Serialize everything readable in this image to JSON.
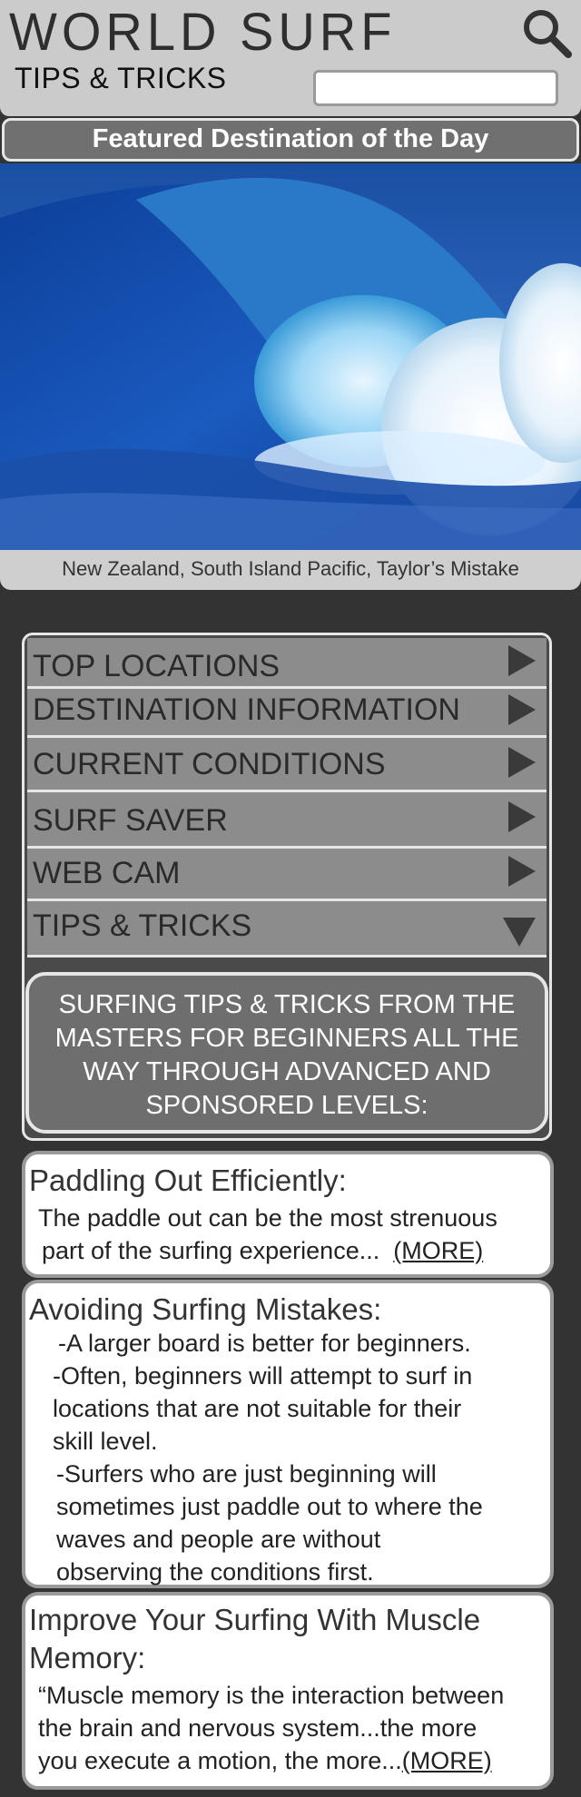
{
  "header": {
    "title": "WORLD SURF",
    "subtitle": "TIPS & TRICKS",
    "search_placeholder": ""
  },
  "featured": {
    "heading": "Featured Destination of the Day",
    "caption": "New Zealand, South Island Pacific, Taylor’s Mistake"
  },
  "menu": {
    "items": [
      {
        "label": "TOP LOCATIONS",
        "icon": "arrow-right-icon"
      },
      {
        "label": "DESTINATION INFORMATION",
        "icon": "arrow-right-icon"
      },
      {
        "label": "CURRENT CONDITIONS",
        "icon": "arrow-right-icon"
      },
      {
        "label": "SURF SAVER",
        "icon": "arrow-right-icon"
      },
      {
        "label": "WEB CAM",
        "icon": "arrow-right-icon"
      },
      {
        "label": "TIPS & TRICKS",
        "icon": "arrow-down-icon"
      }
    ],
    "tips_intro_lines": [
      "SURFING TIPS & TRICKS FROM THE",
      "MASTERS FOR BEGINNERS ALL THE",
      "WAY THROUGH ADVANCED AND",
      "SPONSORED LEVELS:"
    ]
  },
  "cards": [
    {
      "title": "Paddling Out Efficiently:",
      "lines": [
        "The paddle out can be the most strenuous",
        "part of the surfing experience...  "
      ],
      "more": "(MORE)"
    },
    {
      "title": "Avoiding Surfing Mistakes:",
      "lines": [
        "-A larger board is better for beginners.",
        "-Often, beginners will attempt to surf in",
        "locations that are not suitable for their",
        "skill level.",
        "-Surfers who are just beginning will",
        "sometimes just paddle out to where the",
        "waves and people are without",
        "observing the conditions first."
      ]
    },
    {
      "title_lines": [
        "Improve Your Surfing With Muscle",
        "Memory:"
      ],
      "lines": [
        "“Muscle memory is the interaction between",
        "the brain and nervous system...the more",
        "you execute a motion, the more..."
      ],
      "more": "(MORE)"
    }
  ],
  "colors": {
    "background": "#333333",
    "header": "#cbcbcb",
    "menu_item": "#8c8c8c",
    "tips_box": "#6e6e6e"
  }
}
